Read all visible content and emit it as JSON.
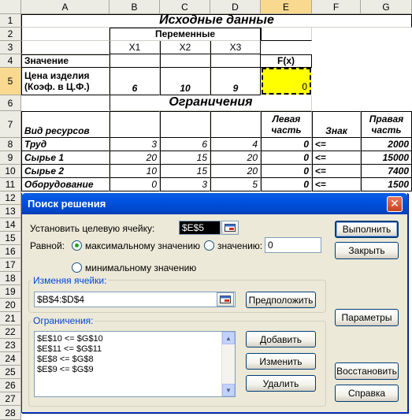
{
  "sheet": {
    "column_headers": [
      "A",
      "B",
      "C",
      "D",
      "E",
      "F",
      "G"
    ],
    "row_headers": [
      "1",
      "2",
      "3",
      "4",
      "5",
      "6",
      "7",
      "8",
      "9",
      "10",
      "11",
      "12",
      "13",
      "14",
      "15",
      "16",
      "17",
      "18",
      "19",
      "20",
      "21",
      "22",
      "23",
      "24",
      "25",
      "26",
      "27",
      "28"
    ],
    "title": "Исходные данные",
    "variables_header": "Переменные",
    "x1": "X1",
    "x2": "X2",
    "x3": "X3",
    "value_label": "Значение",
    "fx_label": "F(x)",
    "price_label_1": "Цена изделия",
    "price_label_2": "(Коэф. в Ц.Ф.)",
    "price_x1": "6",
    "price_x2": "10",
    "price_x3": "9",
    "fx_value": "0",
    "constraints_title": "Ограничения",
    "resource_header": "Вид ресурсов",
    "left_header_1": "Левая",
    "left_header_2": "часть",
    "sign_header": "Знак",
    "right_header_1": "Правая",
    "right_header_2": "часть",
    "rows": [
      {
        "name": "Труд",
        "b": "3",
        "c": "6",
        "d": "4",
        "left": "0",
        "sign": "<=",
        "right": "2000"
      },
      {
        "name": "Сырье 1",
        "b": "20",
        "c": "15",
        "d": "20",
        "left": "0",
        "sign": "<=",
        "right": "15000"
      },
      {
        "name": "Сырье 2",
        "b": "10",
        "c": "15",
        "d": "20",
        "left": "0",
        "sign": "<=",
        "right": "7400"
      },
      {
        "name": "Оборудование",
        "b": "0",
        "c": "3",
        "d": "5",
        "left": "0",
        "sign": "<=",
        "right": "1500"
      }
    ],
    "colors": {
      "header_bg": "#ecebe4",
      "selected_header": "#f9d990",
      "target_fill": "#ffff00"
    }
  },
  "dialog": {
    "title": "Поиск решения",
    "target_label": "Установить целевую ячейку:",
    "target_value": "$E$5",
    "equal_label": "Равной:",
    "opt_max": "максимальному значению",
    "opt_value": "значению:",
    "value_input": "0",
    "opt_min": "минимальному значению",
    "changing_label": "Изменяя ячейки:",
    "changing_value": "$B$4:$D$4",
    "guess_button": "Предположить",
    "constraints_label": "Ограничения:",
    "constraints": [
      "$E$10 <= $G$10",
      "$E$11 <= $G$11",
      "$E$8 <= $G$8",
      "$E$9 <= $G$9"
    ],
    "add_button": "Добавить",
    "change_button": "Изменить",
    "delete_button": "Удалить",
    "solve_button": "Выполнить",
    "close_button": "Закрыть",
    "options_button": "Параметры",
    "reset_button": "Восстановить",
    "help_button": "Справка",
    "selected_option": "max"
  }
}
